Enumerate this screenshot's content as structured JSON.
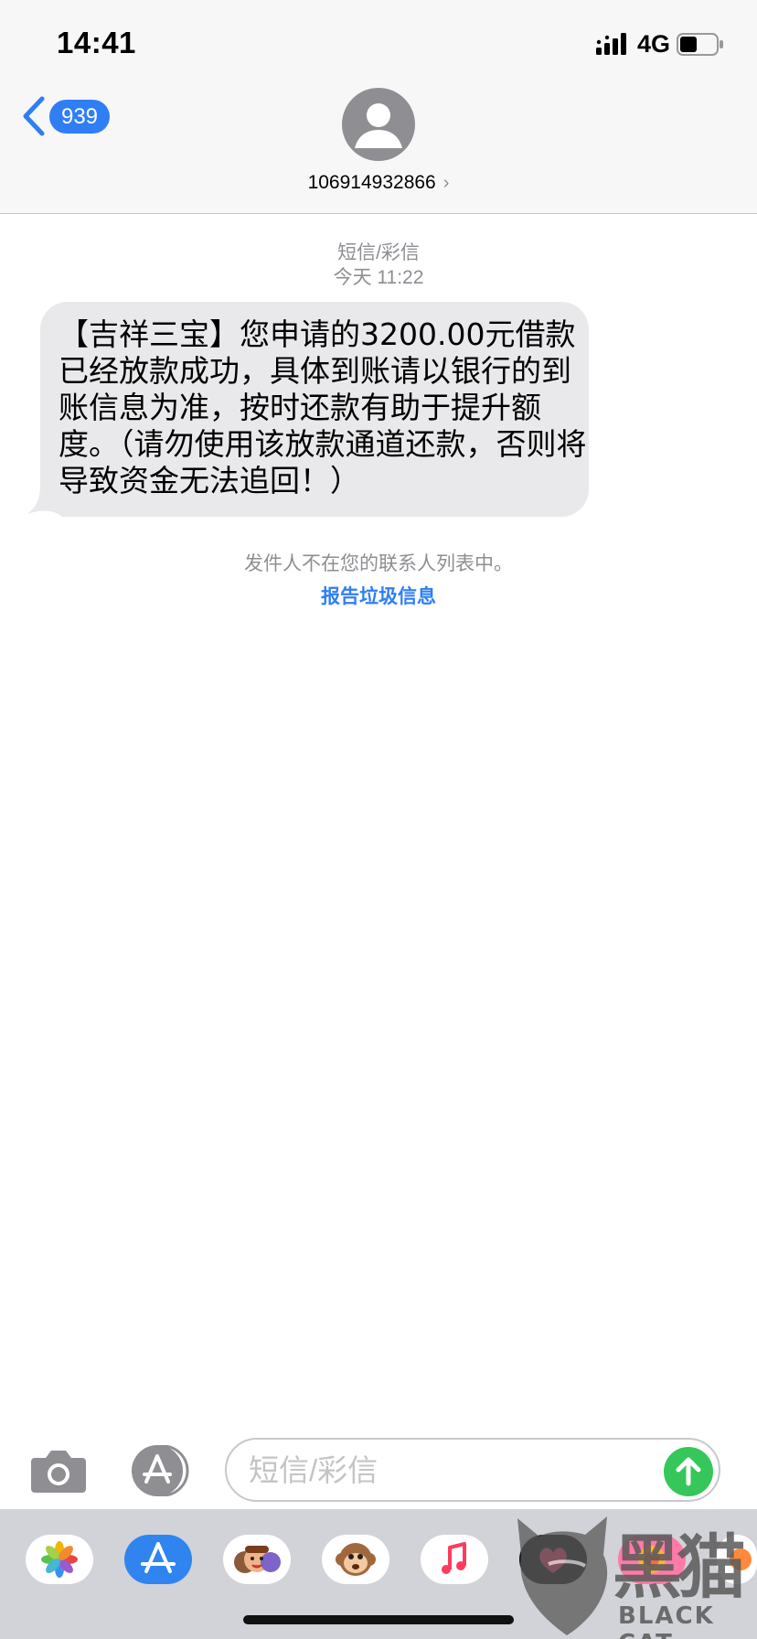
{
  "status_bar": {
    "time": "14:41",
    "network": "4G"
  },
  "nav": {
    "back_badge": "939",
    "contact_number": "106914932866",
    "contact_chevron": "›"
  },
  "thread": {
    "message_type": "短信/彩信",
    "timestamp": "今天 11:22",
    "messages": [
      {
        "direction": "incoming",
        "text": "【吉祥三宝】您申请的3200.00元借款已经放款成功，具体到账请以银行的到账信息为准，按时还款有助于提升额度。（请勿使用该放款通道还款，否则将导致资金无法追回！）"
      }
    ],
    "not_in_contacts_note": "发件人不在您的联系人列表中。",
    "report_link": "报告垃圾信息"
  },
  "composer": {
    "placeholder": "短信/彩信"
  },
  "app_drawer": {
    "apps": [
      "photos-icon",
      "appstore-icon",
      "memoji-icon",
      "animoji-monkey-icon",
      "music-icon",
      "digital-touch-icon",
      "sticker-app-icon",
      "more-app-icon"
    ]
  },
  "watermark": {
    "cn": "黑猫",
    "en": "BLACK CAT"
  },
  "colors": {
    "accent": "#2f7ef6",
    "send": "#35c759",
    "bubble": "#e9e9eb",
    "drawer": "#d2d3d8"
  }
}
